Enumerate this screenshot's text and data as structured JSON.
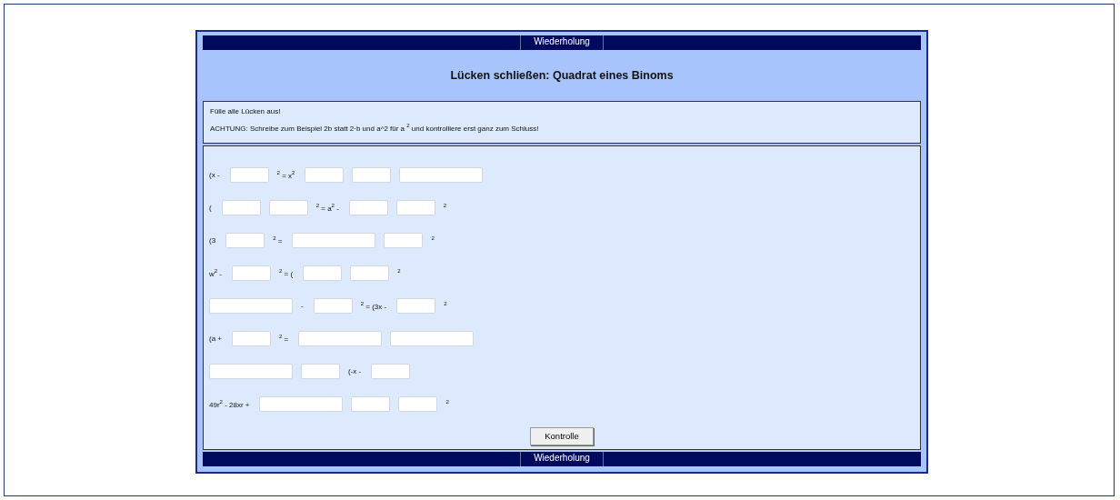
{
  "top_nav": {
    "label": "Wiederholung"
  },
  "title": "Lücken schließen: Quadrat eines Binoms",
  "instructions": [
    "Fülle alle Lücken aus!",
    "ACHTUNG: Schreibe zum Beispiel 2b statt 2·b und a^2 für a $^{2}$ und kontrolliere erst ganz zum Schluss!"
  ],
  "rows": [
    [
      {
        "kind": "text",
        "text": "(x -"
      },
      {
        "kind": "short"
      },
      {
        "kind": "text",
        "text": "$^{2}$ = x$^{2}$"
      },
      {
        "kind": "short"
      },
      {
        "kind": "short"
      },
      {
        "kind": "long"
      }
    ],
    [
      {
        "kind": "text",
        "text": "("
      },
      {
        "kind": "short"
      },
      {
        "kind": "short"
      },
      {
        "kind": "text",
        "text": "$^{2}$ = a$^{2}$ -"
      },
      {
        "kind": "short"
      },
      {
        "kind": "short"
      },
      {
        "kind": "text",
        "text": "$^{2}$"
      }
    ],
    [
      {
        "kind": "text",
        "text": "(3"
      },
      {
        "kind": "short"
      },
      {
        "kind": "text",
        "text": "$^{2}$ ="
      },
      {
        "kind": "long"
      },
      {
        "kind": "short"
      },
      {
        "kind": "text",
        "text": "$^{2}$"
      }
    ],
    [
      {
        "kind": "text",
        "text": "w$^{2}$ -"
      },
      {
        "kind": "short"
      },
      {
        "kind": "text",
        "text": "$^{2}$ = ("
      },
      {
        "kind": "short"
      },
      {
        "kind": "short"
      },
      {
        "kind": "text",
        "text": "$^{2}$"
      }
    ],
    [
      {
        "kind": "long"
      },
      {
        "kind": "text",
        "text": "-"
      },
      {
        "kind": "short"
      },
      {
        "kind": "text",
        "text": "$^{2}$ = (3x -"
      },
      {
        "kind": "short"
      },
      {
        "kind": "text",
        "text": "$^{2}$"
      }
    ],
    [
      {
        "kind": "text",
        "text": "(a +"
      },
      {
        "kind": "short"
      },
      {
        "kind": "text",
        "text": "$^{2}$ ="
      },
      {
        "kind": "long"
      },
      {
        "kind": "long"
      }
    ],
    [
      {
        "kind": "long"
      },
      {
        "kind": "short"
      },
      {
        "kind": "text",
        "text": "(-x -"
      },
      {
        "kind": "short"
      }
    ],
    [
      {
        "kind": "text",
        "text": "49r$^{2}$ - 28xr +"
      },
      {
        "kind": "long"
      },
      {
        "kind": "short"
      },
      {
        "kind": "short"
      },
      {
        "kind": "text",
        "text": "$^{2}$"
      }
    ]
  ],
  "check_button": "Kontrolle",
  "bottom_nav": {
    "label": "Wiederholung"
  }
}
